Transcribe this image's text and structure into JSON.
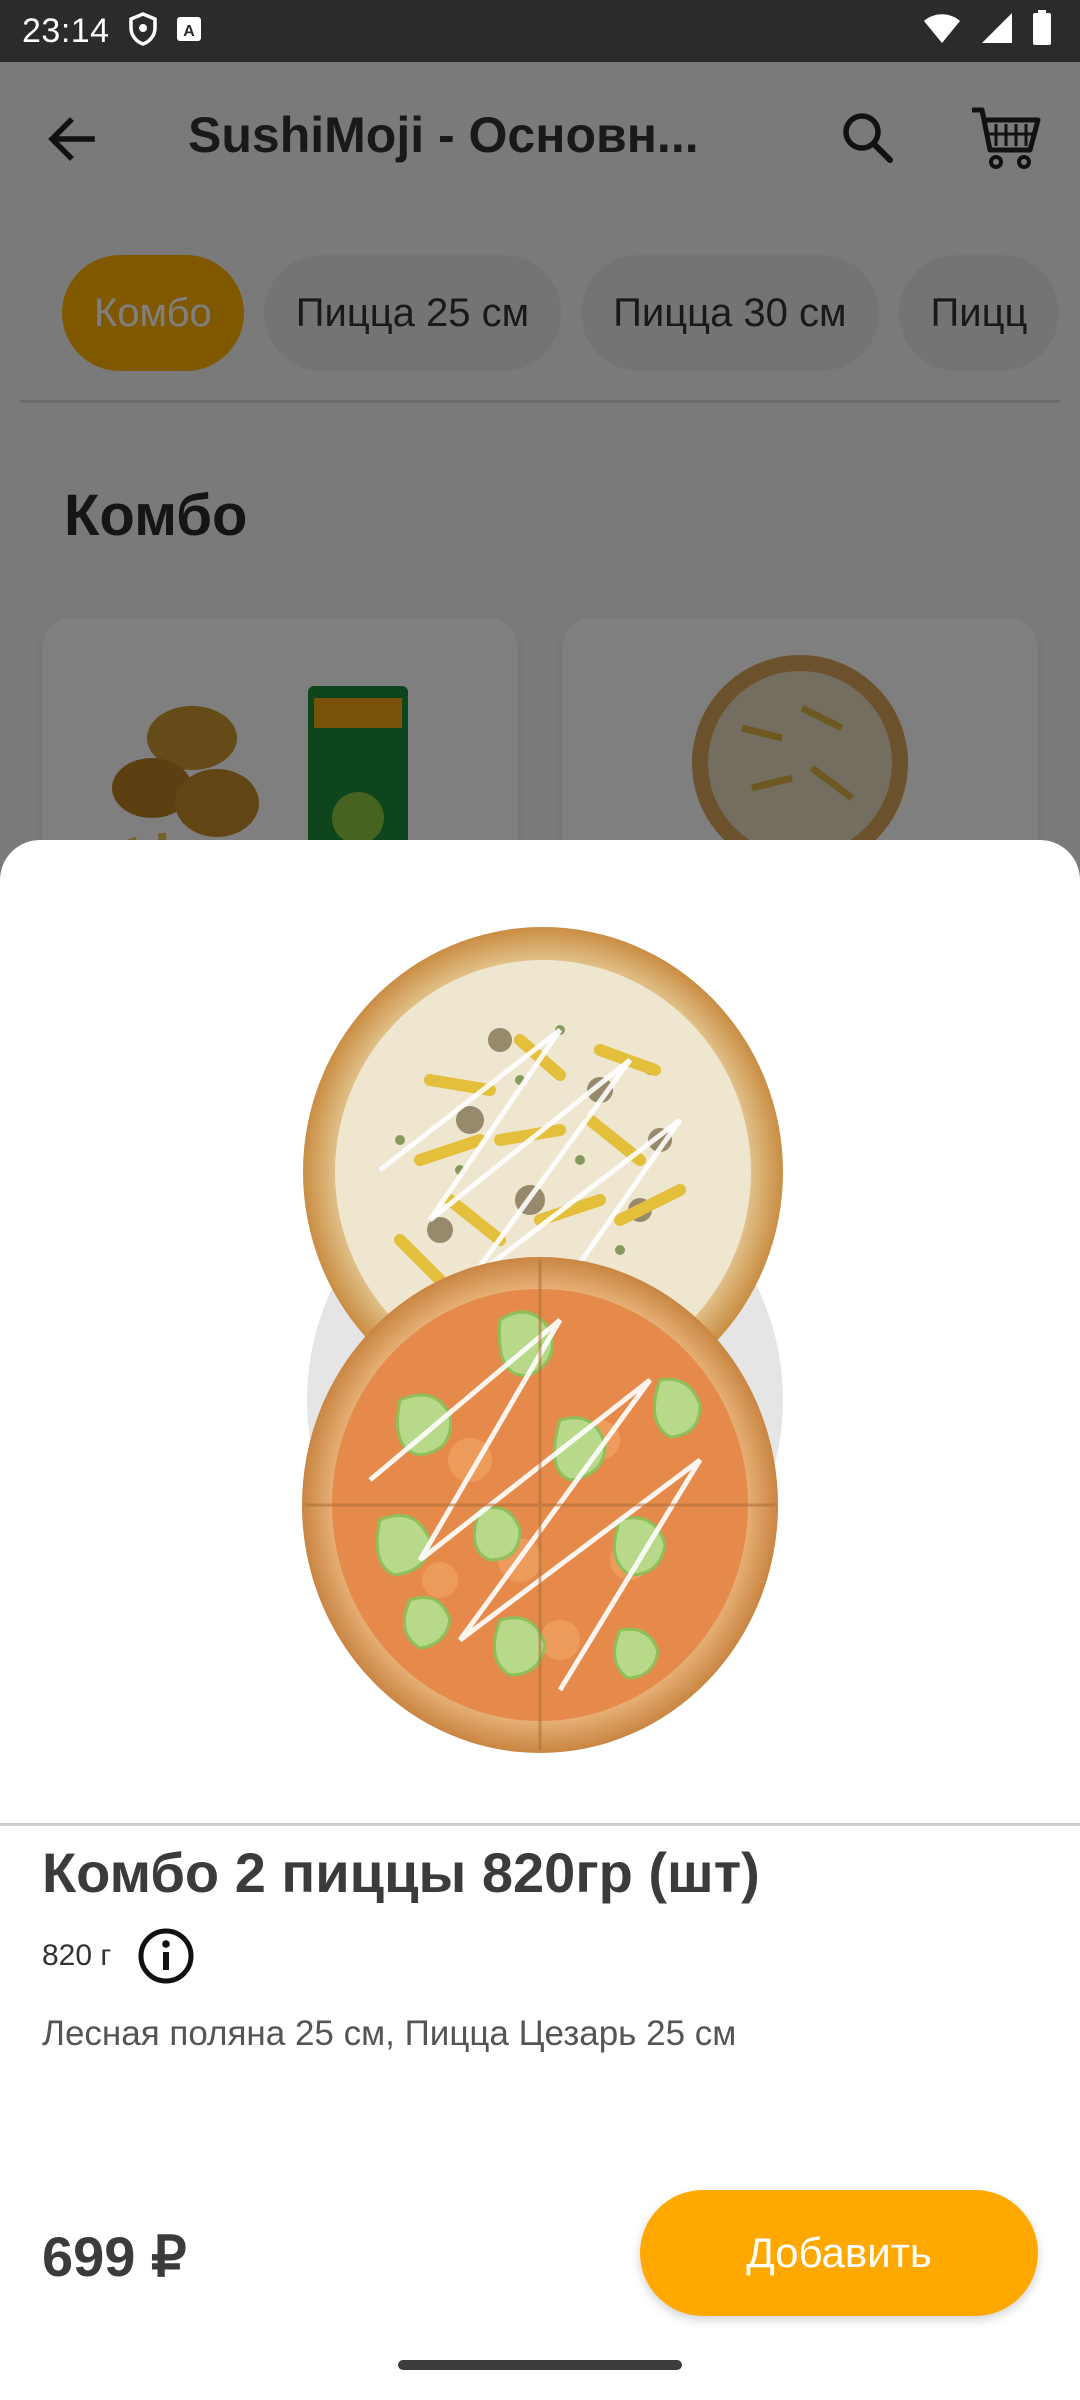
{
  "status_bar": {
    "time": "23:14",
    "icons": [
      "shield-icon",
      "a-notification-icon",
      "wifi-icon",
      "signal-icon",
      "battery-icon"
    ]
  },
  "toolbar": {
    "title": "SushiMoji - Основн...",
    "back_icon": "arrow-left-icon",
    "search_icon": "search-icon",
    "cart_icon": "cart-icon"
  },
  "categories": [
    {
      "label": "Комбо",
      "active": true
    },
    {
      "label": "Пицца 25 см",
      "active": false
    },
    {
      "label": "Пицца 30 см",
      "active": false
    },
    {
      "label": "Пицц",
      "active": false
    }
  ],
  "section_title": "Комбо",
  "product": {
    "name": "Комбо 2 пиццы 820гр (шт)",
    "weight": "820 г",
    "description": "Лесная поляна 25 см, Пицца Цезарь 25 см",
    "price": "699 ₽",
    "add_label": "Добавить"
  },
  "colors": {
    "accent": "#ffa800",
    "scrim": "rgba(0,0,0,0.5)"
  }
}
